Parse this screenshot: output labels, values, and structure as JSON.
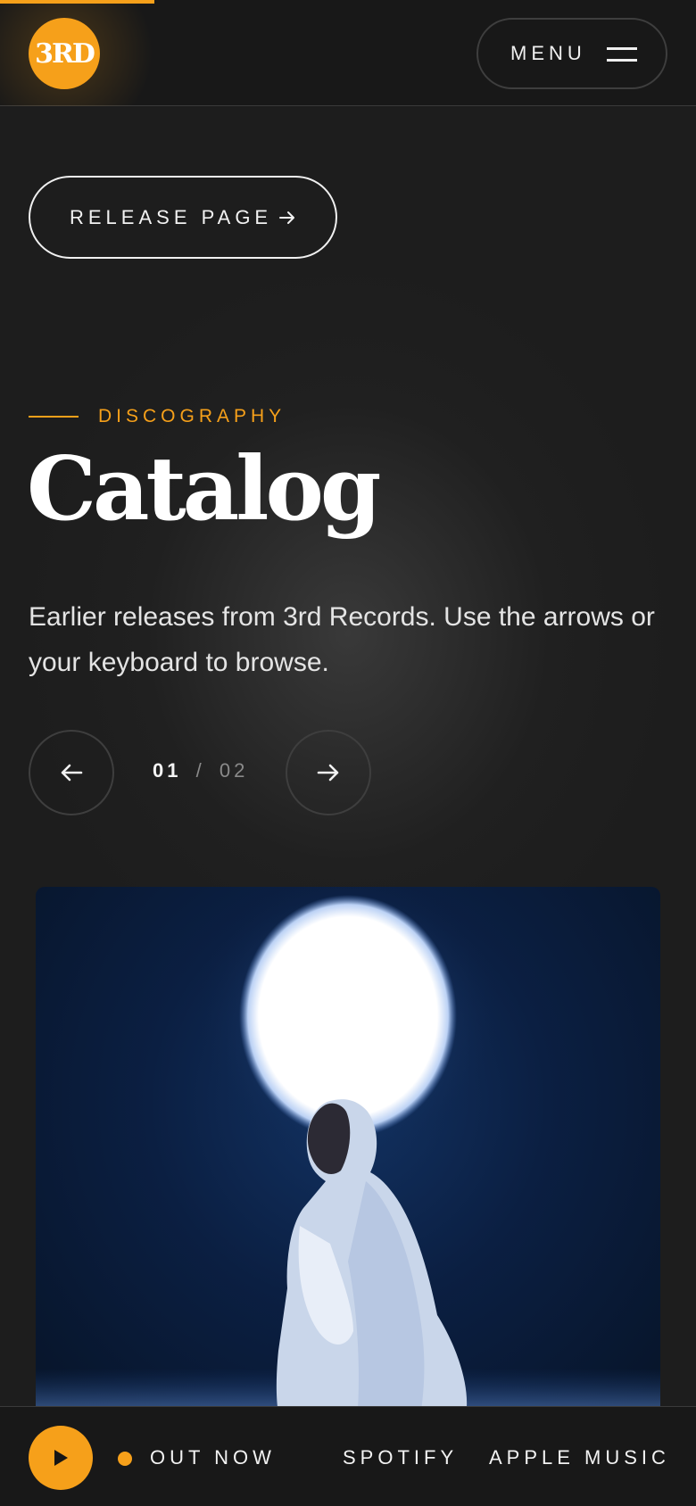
{
  "header": {
    "logo_text": "3RD",
    "menu_label": "MENU"
  },
  "release": {
    "button_label": "RELEASE PAGE"
  },
  "section": {
    "eyebrow": "DISCOGRAPHY",
    "title": "Catalog",
    "description": "Earlier releases from 3rd Records. Use the arrows or your keyboard to browse."
  },
  "pager": {
    "current": "01",
    "separator": "/",
    "total": "02"
  },
  "player": {
    "status": "OUT NOW",
    "links": [
      "SPOTIFY",
      "APPLE MUSIC"
    ]
  },
  "colors": {
    "accent": "#f6a01a",
    "background": "#1d1d1d"
  },
  "icons": {
    "menu": "hamburger-icon",
    "release_arrow": "arrow-right-icon",
    "prev": "arrow-left-icon",
    "next": "arrow-right-icon",
    "play": "play-icon"
  }
}
